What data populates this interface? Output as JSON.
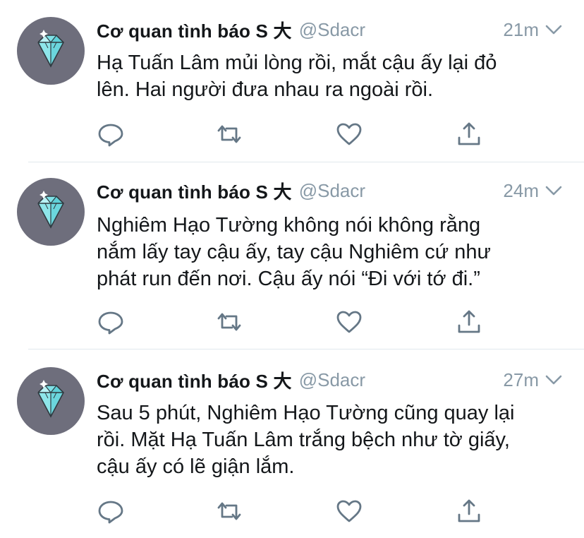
{
  "colors": {
    "text": "#14171a",
    "muted": "#8899a6",
    "icon": "#657786",
    "avatar_bg": "#6e6e7c",
    "gem": "#7fe0e6",
    "separator": "#e1e8ed"
  },
  "tweets": [
    {
      "author_name": "Cơ quan tình báo S 大",
      "handle": "@Sdacr",
      "time": "21m",
      "lines": [
        "Hạ Tuấn Lâm mủi lòng rồi, mắt cậu ấy lại đỏ",
        "lên. Hai người đưa nhau ra ngoài rồi."
      ]
    },
    {
      "author_name": "Cơ quan tình báo S 大",
      "handle": "@Sdacr",
      "time": "24m",
      "lines": [
        "Nghiêm Hạo Tường không nói không rằng",
        "nắm lấy tay cậu ấy, tay cậu Nghiêm cứ như",
        "phát run đến nơi. Cậu ấy nói “Đi với tớ đi.”"
      ]
    },
    {
      "author_name": "Cơ quan tình báo S 大",
      "handle": "@Sdacr",
      "time": "27m",
      "lines": [
        "Sau 5 phút, Nghiêm Hạo Tường cũng quay lại",
        "rồi. Mặt Hạ Tuấn Lâm trắng bệch như tờ giấy,",
        "cậu ấy có lẽ giận lắm."
      ]
    }
  ],
  "icons": {
    "reply": "reply-icon",
    "retweet": "retweet-icon",
    "like": "heart-icon",
    "share": "share-icon",
    "caret": "chevron-down-icon",
    "avatar": "diamond-avatar"
  }
}
